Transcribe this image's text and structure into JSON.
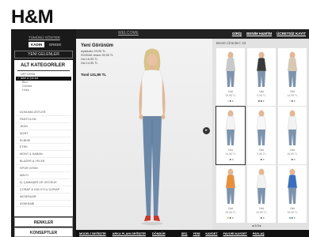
{
  "brand": {
    "logo": "H&M"
  },
  "topbar": {
    "center_link": "WELCOME",
    "links": [
      "GİRİŞ",
      "BENİM H&M'İM",
      "ÜCRETSİZ KAYIT"
    ]
  },
  "sidebar": {
    "toplink": "TÜMÜNÜ GÖSTER",
    "gender": {
      "active": "KADIN",
      "inactive": "ERKEK"
    },
    "new_button": "YENİ GELENLER",
    "cat_title": "ALT KATEGORİLER",
    "subcats": [
      {
        "label": "ÜST GİYİM",
        "selected": false,
        "small": false
      },
      {
        "label": "Atlet & Şık kol",
        "selected": true,
        "small": false
      },
      {
        "label": "Bluz",
        "selected": false,
        "small": true
      },
      {
        "label": "Gömlek",
        "selected": false,
        "small": true
      },
      {
        "label": "Hırka",
        "selected": false,
        "small": true
      }
    ],
    "categories": [
      "DOKUMA ÜSTLER",
      "PANTOLON",
      "JEAN",
      "ŞORT",
      "ELBİSE",
      "ETEK",
      "MONT & KABAN",
      "BLAZER & YELEK",
      "SPOR GİYİM",
      "MAYO",
      "İÇ ÇAMAŞIRI VE GECELİK",
      "ÇORAP & KÜLOTLU ÇORAP",
      "AKSESUAR",
      "AYAKKABI"
    ],
    "colors_button": "RENKLER",
    "concepts_button": "KONSEPTLER"
  },
  "look": {
    "title": "Yeni Görünüm",
    "items": [
      "Ayakkabı 29,95 TL",
      "SOHNM Jeans 39,95 TL",
      "Üst 16,95 TL",
      "Üst 14,95 TL"
    ],
    "total": "Toml 131,80 TL"
  },
  "products": {
    "header": "Benim Ürünleri: 23",
    "items": [
      {
        "name": "Üst",
        "price": "29,95 TL",
        "color": "#c9c9c9"
      },
      {
        "name": "Üst",
        "price": "9,95 TL",
        "color": "#3a3a3a"
      },
      {
        "name": "Üst",
        "price": "14,95 TL",
        "color": "#d8c9b2"
      },
      {
        "name": "Üst",
        "price": "14,95 TL",
        "color": "#f4f4f4"
      },
      {
        "name": "Üst",
        "price": "9,95 TL",
        "color": "#f7f7f7"
      },
      {
        "name": "Üst",
        "price": "16,95 TL",
        "color": "#f2f2f2"
      },
      {
        "name": "Üst",
        "price": "29,95 TL",
        "color": "#e98f3a"
      },
      {
        "name": "Üst",
        "price": "29,95 TL",
        "color": "#f2f2f2"
      },
      {
        "name": "Üst",
        "price": "16,95 TL",
        "color": "#3a6fbf"
      }
    ],
    "pager": "2/3"
  },
  "bottom": {
    "left": [
      "MODELİ DEĞİŞTİR",
      "ARKA PLANI DEĞİŞTİR",
      "DÖNDÜR"
    ],
    "right": [
      "SEÇ",
      "YENİ",
      "KAYDET",
      "FAVORİ KAYDET",
      "PAYLAŞ"
    ]
  }
}
